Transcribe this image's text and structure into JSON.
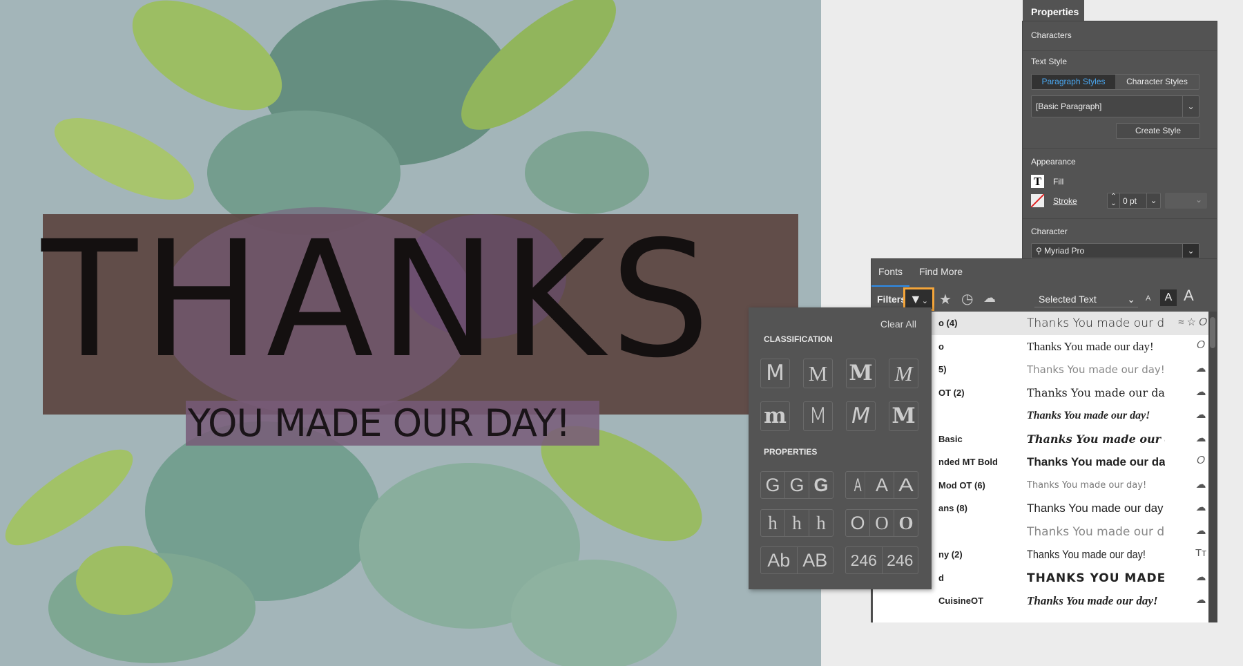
{
  "artwork": {
    "headline": "THANKS",
    "subline": "YOU MADE OUR DAY!"
  },
  "properties": {
    "tab": "Properties",
    "characters_label": "Characters",
    "text_style_label": "Text Style",
    "paragraph_styles": "Paragraph Styles",
    "character_styles": "Character Styles",
    "style_value": "[Basic Paragraph]",
    "create_style": "Create Style",
    "appearance_label": "Appearance",
    "fill_label": "Fill",
    "stroke_label": "Stroke",
    "stroke_value": "0 pt",
    "character_label": "Character",
    "font_value": "Myriad Pro"
  },
  "fonts_panel": {
    "tabs": [
      "Fonts",
      "Find More"
    ],
    "filters_label": "Filters",
    "preview_select": "Selected Text",
    "size_options": [
      "A",
      "A",
      "A"
    ],
    "rows": [
      {
        "name": "o (4)",
        "sample": "Thanks You made our d",
        "icon": "activated"
      },
      {
        "name": "o",
        "sample": "Thanks You made our day!",
        "icon": "opentype"
      },
      {
        "name": "5)",
        "sample": "Thanks You made our day!",
        "icon": "cloud-sync"
      },
      {
        "name": "OT (2)",
        "sample": "Thanks You made our day!",
        "icon": "cloud-sync"
      },
      {
        "name": "",
        "sample": "Thanks You made our day!",
        "icon": "cloud-sync"
      },
      {
        "name": "Basic",
        "sample": "Thanks You made our day!",
        "icon": "cloud-sync"
      },
      {
        "name": "nded MT Bold",
        "sample": "Thanks You made our day!",
        "icon": "opentype"
      },
      {
        "name": "Mod OT (6)",
        "sample": "Thanks You made our day!",
        "icon": "cloud-sync"
      },
      {
        "name": "ans (8)",
        "sample": "Thanks You made our day",
        "icon": "cloud-sync"
      },
      {
        "name": "",
        "sample": "Thanks You made our day",
        "icon": "cloud-sync"
      },
      {
        "name": "ny (2)",
        "sample": "Thanks You made our day!",
        "icon": "truetype"
      },
      {
        "name": "d",
        "sample": "THANKS YOU MADE OUR DAY!",
        "icon": "cloud-sync"
      },
      {
        "name": "CuisineOT",
        "sample": "Thanks You made our day!",
        "icon": "cloud-sync"
      }
    ]
  },
  "filter_popup": {
    "clear_all": "Clear All",
    "classification_label": "CLASSIFICATION",
    "classification": [
      "M",
      "M",
      "M",
      "M",
      "m",
      "M",
      "M",
      "M"
    ],
    "properties_label": "PROPERTIES",
    "weight": [
      "G",
      "G",
      "G"
    ],
    "width": [
      "A",
      "A",
      "A"
    ],
    "xheight": [
      "h",
      "h",
      "h"
    ],
    "contrast": [
      "O",
      "O",
      "O"
    ],
    "case": [
      "Ab",
      "AB"
    ],
    "numerals": [
      "246",
      "246"
    ]
  },
  "colors": {
    "accent": "#2d8ceb",
    "highlight": "#f4a53a",
    "panel": "#535353",
    "canvas": "#a3b5b9",
    "banner": "#5b4541"
  }
}
